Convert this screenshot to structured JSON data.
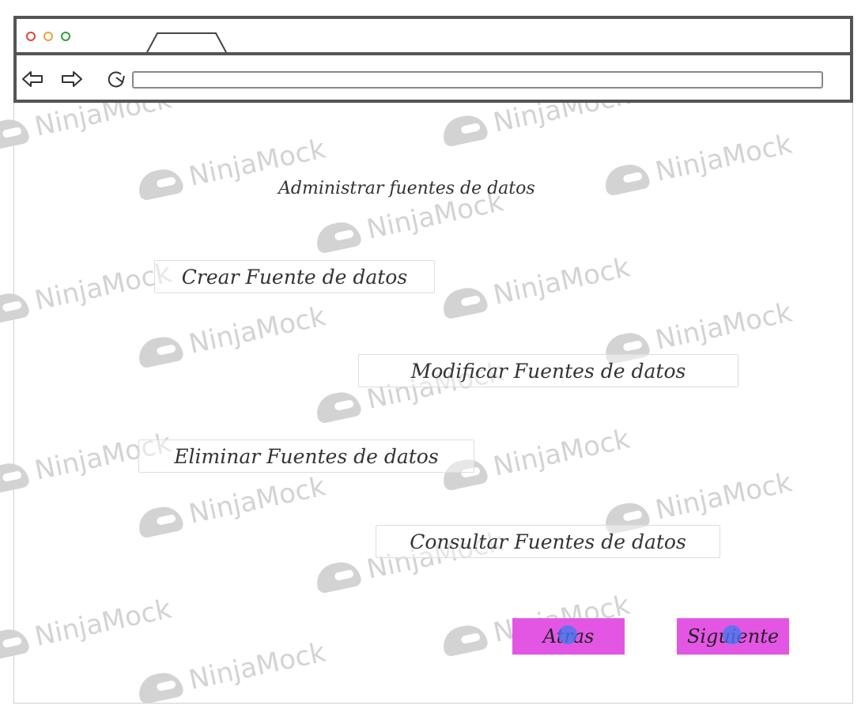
{
  "watermark": {
    "text": "NinjaMock"
  },
  "browser": {
    "window_controls": [
      "close",
      "minimize",
      "maximize"
    ],
    "tab_label": "",
    "url": "",
    "icons": [
      "back-arrow-icon",
      "forward-arrow-icon",
      "reload-icon"
    ]
  },
  "page": {
    "heading": "Administrar fuentes de datos",
    "actions": {
      "crear": "Crear  Fuente de datos",
      "modificar": "Modificar  Fuentes  de datos",
      "eliminar": "Eliminar Fuentes  de datos",
      "consultar": "Consultar  Fuentes de datos"
    },
    "navigation": {
      "atras": "Atras",
      "siguiente": "Siguiente"
    }
  },
  "colors": {
    "nav_button_bg": "#e356e4",
    "chrome_border": "#555555",
    "click_marker": "#4678f0",
    "watermark": "#d3d3d3"
  }
}
